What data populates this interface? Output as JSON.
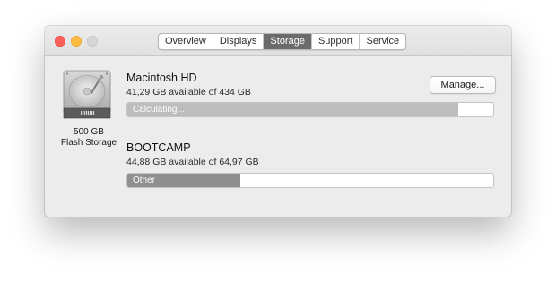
{
  "window": {
    "traffic_lights": [
      "close",
      "minimize",
      "zoom"
    ]
  },
  "tabs": [
    {
      "label": "Overview",
      "active": false
    },
    {
      "label": "Displays",
      "active": false
    },
    {
      "label": "Storage",
      "active": true
    },
    {
      "label": "Support",
      "active": false
    },
    {
      "label": "Service",
      "active": false
    }
  ],
  "drive": {
    "icon": "hard-drive-icon",
    "capacity": "500 GB",
    "type": "Flash Storage"
  },
  "volumes": [
    {
      "name": "Macintosh HD",
      "availability": "41,29 GB available of 434 GB",
      "bar_label": "Calculating...",
      "bar_fill_fraction": 0.905,
      "bar_color": "#bdbdbd",
      "button_label": "Manage..."
    },
    {
      "name": "BOOTCAMP",
      "availability": "44,88 GB available of 64,97 GB",
      "bar_label": "Other",
      "bar_fill_fraction": 0.309,
      "bar_color": "#8f8f8f"
    }
  ]
}
